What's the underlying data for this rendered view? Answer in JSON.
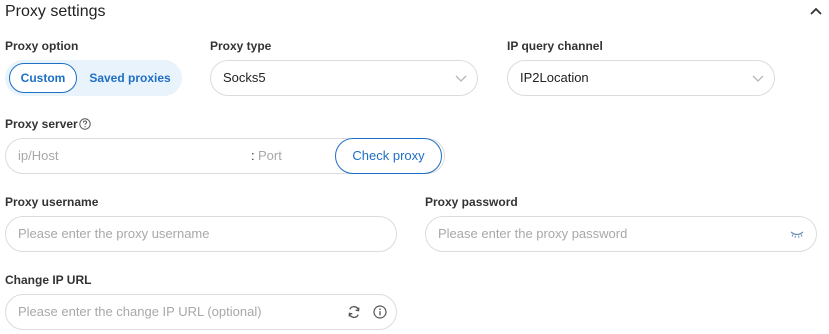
{
  "section": {
    "title": "Proxy settings"
  },
  "proxy_option": {
    "label": "Proxy option",
    "options": [
      "Custom",
      "Saved proxies"
    ],
    "selected": "Custom"
  },
  "proxy_type": {
    "label": "Proxy type",
    "value": "Socks5"
  },
  "ip_query_channel": {
    "label": "IP query channel",
    "value": "IP2Location"
  },
  "proxy_server": {
    "label": "Proxy server",
    "host_placeholder": "ip/Host",
    "port_separator": ":",
    "port_placeholder": "Port",
    "check_label": "Check proxy"
  },
  "proxy_username": {
    "label": "Proxy username",
    "placeholder": "Please enter the proxy username"
  },
  "proxy_password": {
    "label": "Proxy password",
    "placeholder": "Please enter the proxy password"
  },
  "change_ip_url": {
    "label": "Change IP URL",
    "placeholder": "Please enter the change IP URL (optional)"
  },
  "colors": {
    "accent": "#1f6fc5",
    "segment_bg": "#e8f3fc",
    "border": "#dcdcdc",
    "placeholder": "#a8a8a8"
  }
}
